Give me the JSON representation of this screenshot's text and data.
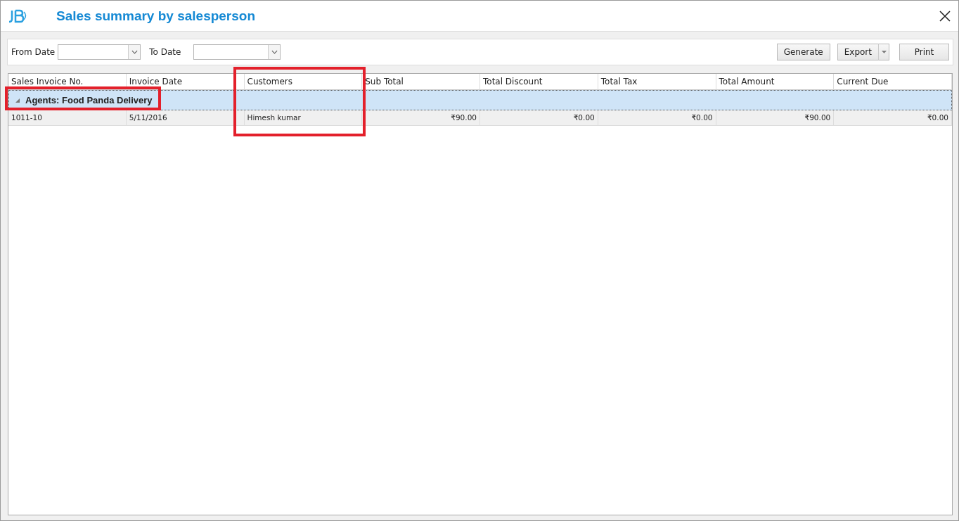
{
  "window": {
    "title": "Sales summary by salesperson"
  },
  "filters": [
    {
      "label": "From Date"
    },
    {
      "label": "To Date"
    }
  ],
  "buttons": [
    {
      "label": "Generate",
      "kind": "plain"
    },
    {
      "label": "Export",
      "kind": "split"
    },
    {
      "label": "Print",
      "kind": "plain"
    }
  ],
  "table": {
    "columns": [
      "Sales Invoice No.",
      "Invoice Date",
      "Customers",
      "Sub Total",
      "Total Discount",
      "Total Tax",
      "Total Amount",
      "Current Due"
    ],
    "groups": [
      {
        "label": "Agents: Food Panda Delivery",
        "expanded": true,
        "rows": [
          {
            "cells": [
              "1011-10",
              "5/11/2016",
              "Himesh kumar",
              "₹90.00",
              "₹0.00",
              "₹0.00",
              "₹90.00",
              "₹0.00"
            ]
          }
        ]
      }
    ]
  }
}
